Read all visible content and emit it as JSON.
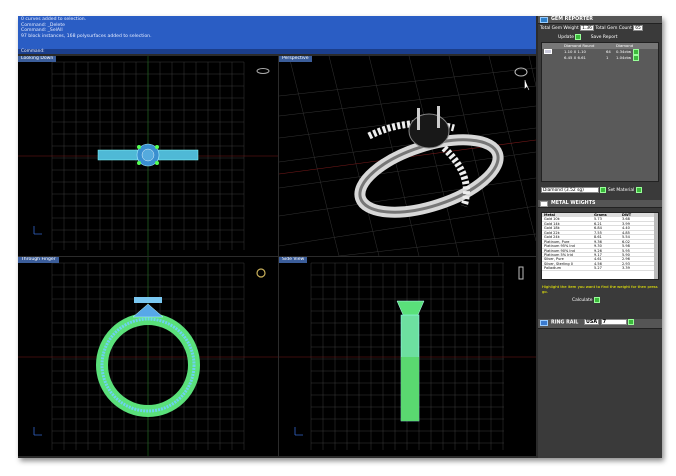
{
  "command_log": [
    "0 curves added to selection.",
    "Command: _Delete",
    "Command: _SelAll",
    "97 block instances, 168 polysurfaces added to selection."
  ],
  "command_prompt": "Command:",
  "viewports": {
    "top": "Looking Down",
    "perspective": "Perspective",
    "front": "Through Finger",
    "side": "Side View"
  },
  "gem_reporter": {
    "title": "GEM REPORTER",
    "total_weight_label": "Total Gem Weight",
    "total_weight": "1.36",
    "total_count_label": "Total Gem Count",
    "total_count": "65",
    "update": "Update",
    "save_report": "Save Report",
    "cols": [
      "Diamond Round",
      "",
      "Diamond"
    ],
    "rows": [
      [
        "1.10 X 1.10",
        "64",
        "0.34ctw"
      ],
      [
        "6.45 X 6.61",
        "1",
        "1.04ctw"
      ]
    ]
  },
  "material": {
    "value": "Diamond (3.52 sg)",
    "set_label": "Set Material"
  },
  "metal_weights": {
    "title": "METAL WEIGHTS",
    "cols": [
      "Metal",
      "Grams",
      "DWT"
    ],
    "rows": [
      [
        "Gold 10k",
        "5.73",
        "3.68"
      ],
      [
        "Gold 14k",
        "6.21",
        "3.99"
      ],
      [
        "Gold 18k",
        "6.84",
        "4.40"
      ],
      [
        "Gold 22k",
        "7.55",
        "4.85"
      ],
      [
        "Gold 24k",
        "8.61",
        "5.54"
      ],
      [
        "Platinum, Pure",
        "9.36",
        "6.02"
      ],
      [
        "Platinum 95% Ind",
        "9.30",
        "5.98"
      ],
      [
        "Platinum 90% Ind",
        "9.26",
        "5.95"
      ],
      [
        "Platinum 5% Irid",
        "9.17",
        "5.90"
      ],
      [
        "Silver, Pure",
        "4.61",
        "2.96"
      ],
      [
        "Silver, Sterling 0",
        "4.56",
        "2.93"
      ],
      [
        "Palladium",
        "5.27",
        "3.39"
      ]
    ],
    "hint": "Highlight the item you want to find the weight for then press go.",
    "calculate": "Calculate"
  },
  "ring_rail": {
    "title": "RING RAIL",
    "standard": "USA",
    "size": "7"
  }
}
